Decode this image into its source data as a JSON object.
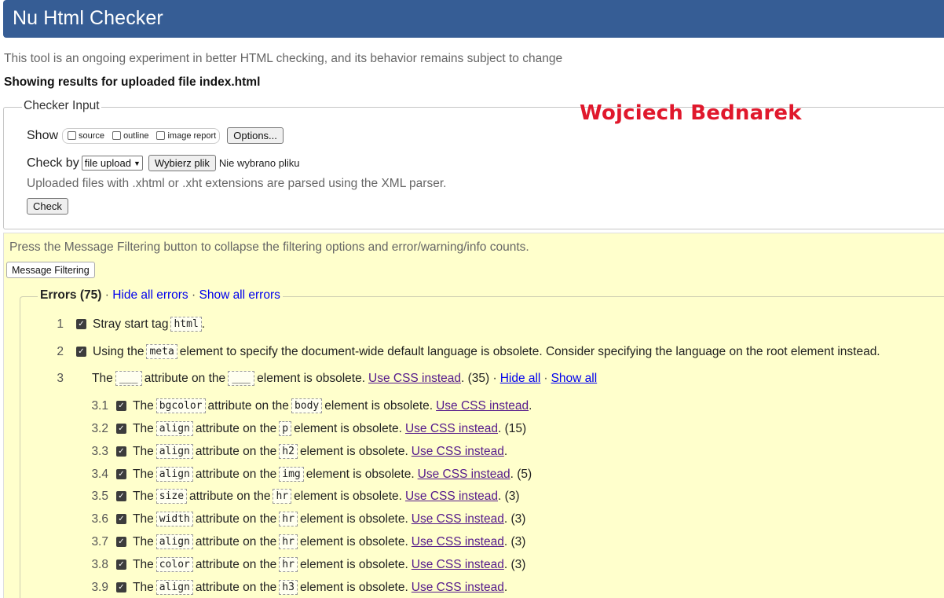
{
  "app": {
    "title": "Nu Html Checker"
  },
  "tagline": "This tool is an ongoing experiment in better HTML checking, and its behavior remains subject to change",
  "results_for": "Showing results for uploaded file index.html",
  "watermark": "Wojciech Bednarek",
  "checker": {
    "legend": "Checker Input",
    "show_label": "Show",
    "show_options": [
      {
        "label": "source",
        "checked": false
      },
      {
        "label": "outline",
        "checked": false
      },
      {
        "label": "image report",
        "checked": false
      }
    ],
    "options_button": "Options...",
    "check_by_label": "Check by",
    "check_by_value": "file upload",
    "file_button": "Wybierz plik",
    "file_status": "Nie wybrano pliku",
    "note": "Uploaded files with .xhtml or .xht extensions are parsed using the XML parser.",
    "check_button": "Check"
  },
  "filtering": {
    "note": "Press the Message Filtering button to collapse the filtering options and error/warning/info counts.",
    "button": "Message Filtering"
  },
  "errors": {
    "title": "Errors (75)",
    "hide_all": "Hide all errors",
    "show_all": "Show all errors",
    "dot": "·"
  },
  "messages": [
    {
      "num": "1",
      "pre": "Stray start tag",
      "code": "html",
      "post": "."
    },
    {
      "num": "2",
      "pre": "Using the",
      "code": "meta",
      "post": "element to specify the document-wide default language is obsolete. Consider specifying the language on the root element instead."
    },
    {
      "num": "3",
      "the": "The",
      "code1": "___",
      "mid": "attribute on the",
      "code2": "___",
      "post": "element is obsolete.",
      "link": "Use CSS instead",
      "count": ". (35) ·",
      "hide": "Hide all",
      "show": "Show all"
    }
  ],
  "sub_messages": [
    {
      "num": "3.1",
      "the": "The",
      "attr": "bgcolor",
      "mid": "attribute on the",
      "el": "body",
      "post": "element is obsolete.",
      "link": "Use CSS instead",
      "count": "."
    },
    {
      "num": "3.2",
      "the": "The",
      "attr": "align",
      "mid": "attribute on the",
      "el": "p",
      "post": "element is obsolete.",
      "link": "Use CSS instead",
      "count": ". (15)"
    },
    {
      "num": "3.3",
      "the": "The",
      "attr": "align",
      "mid": "attribute on the",
      "el": "h2",
      "post": "element is obsolete.",
      "link": "Use CSS instead",
      "count": "."
    },
    {
      "num": "3.4",
      "the": "The",
      "attr": "align",
      "mid": "attribute on the",
      "el": "img",
      "post": "element is obsolete.",
      "link": "Use CSS instead",
      "count": ". (5)"
    },
    {
      "num": "3.5",
      "the": "The",
      "attr": "size",
      "mid": "attribute on the",
      "el": "hr",
      "post": "element is obsolete.",
      "link": "Use CSS instead",
      "count": ". (3)"
    },
    {
      "num": "3.6",
      "the": "The",
      "attr": "width",
      "mid": "attribute on the",
      "el": "hr",
      "post": "element is obsolete.",
      "link": "Use CSS instead",
      "count": ". (3)"
    },
    {
      "num": "3.7",
      "the": "The",
      "attr": "align",
      "mid": "attribute on the",
      "el": "hr",
      "post": "element is obsolete.",
      "link": "Use CSS instead",
      "count": ". (3)"
    },
    {
      "num": "3.8",
      "the": "The",
      "attr": "color",
      "mid": "attribute on the",
      "el": "hr",
      "post": "element is obsolete.",
      "link": "Use CSS instead",
      "count": ". (3)"
    },
    {
      "num": "3.9",
      "the": "The",
      "attr": "align",
      "mid": "attribute on the",
      "el": "h3",
      "post": "element is obsolete.",
      "link": "Use CSS instead",
      "count": "."
    }
  ],
  "colors": {
    "header_bg": "#365d95",
    "filter_bg": "#ffffcc",
    "watermark": "#e0182c",
    "link": "#0000ee",
    "visited_link": "#551a8b"
  }
}
